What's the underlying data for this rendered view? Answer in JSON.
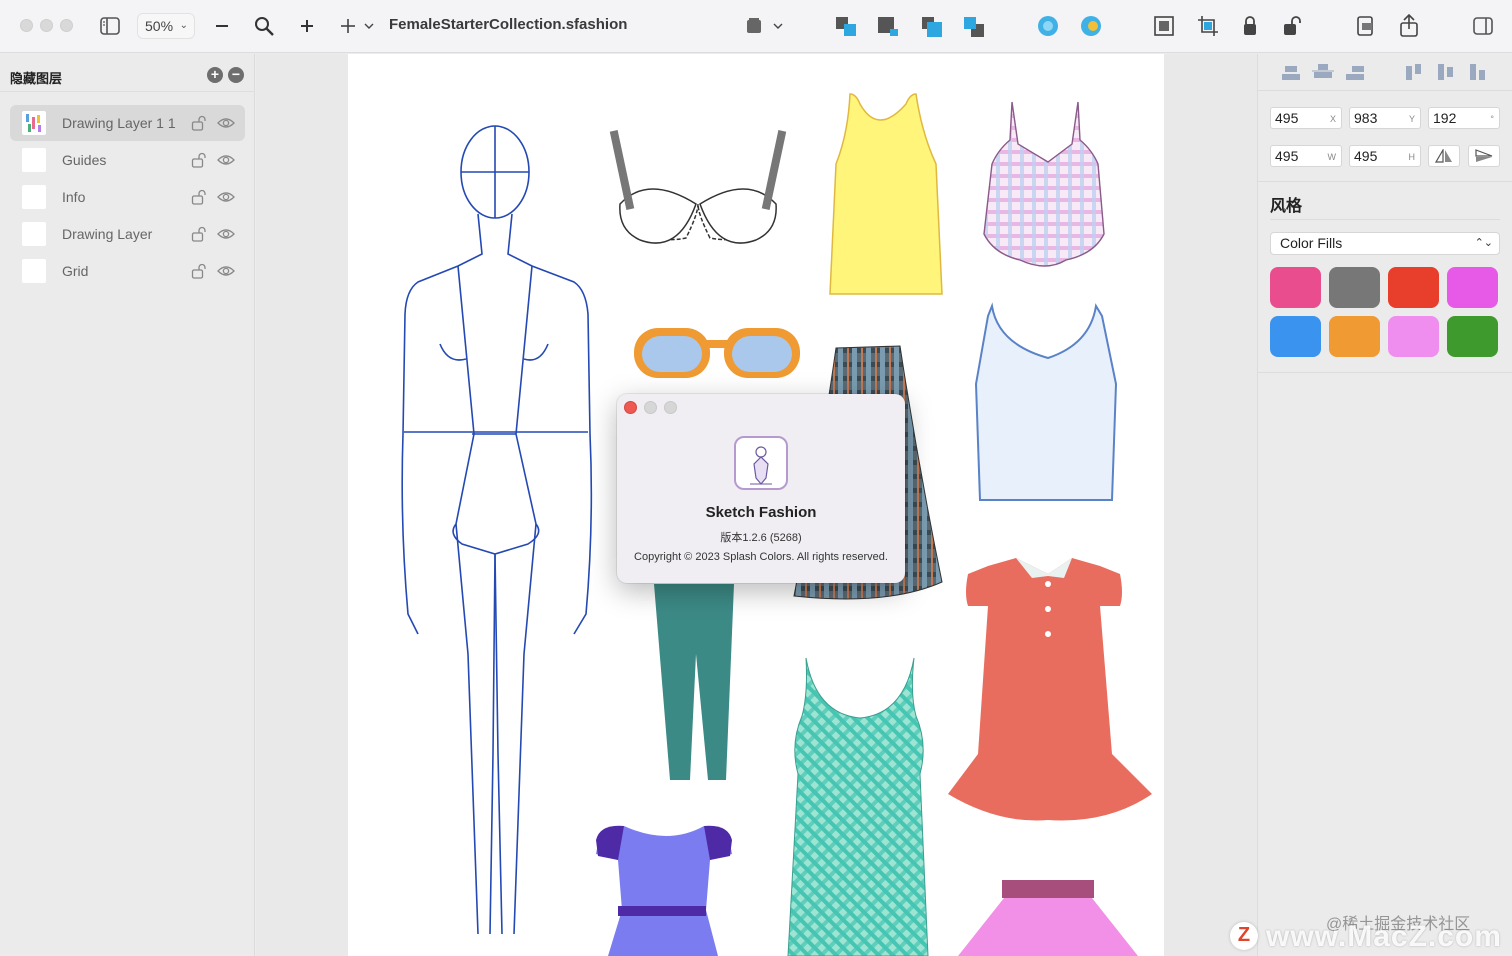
{
  "window": {
    "document_title": "FemaleStarterCollection.sfashion",
    "zoom_level": "50%"
  },
  "toolbar": {
    "icons": [
      "sidebar-toggle-icon",
      "zoom-out-icon",
      "magnifier-icon",
      "zoom-in-icon",
      "add-icon",
      "artboard-icon",
      "arrange-front-icon",
      "arrange-forward-icon",
      "arrange-backward-icon",
      "arrange-back-icon",
      "union-icon",
      "subtract-icon",
      "fit-icon",
      "crop-icon",
      "lock-icon",
      "unlock-icon",
      "export-icon",
      "share-icon",
      "inspector-toggle-icon"
    ]
  },
  "sidebar": {
    "header": "隐藏图层",
    "layers": [
      {
        "name": "Drawing Layer 1 1",
        "selected": true
      },
      {
        "name": "Guides",
        "selected": false
      },
      {
        "name": "Info",
        "selected": false
      },
      {
        "name": "Drawing Layer",
        "selected": false
      },
      {
        "name": "Grid",
        "selected": false
      }
    ]
  },
  "inspector": {
    "x_value": "495",
    "x_label": "X",
    "y_value": "983",
    "y_label": "Y",
    "rotation_value": "192",
    "rotation_label": "°",
    "w_value": "495",
    "w_label": "W",
    "h_value": "495",
    "h_label": "H",
    "style_title": "风格",
    "fill_select": "Color Fills",
    "swatches": [
      "#ea4d8e",
      "#777777",
      "#e83e2c",
      "#e75ae8",
      "#3b93f0",
      "#ef9a32",
      "#f08ef0",
      "#3e9a2c"
    ]
  },
  "about_dialog": {
    "app_name": "Sketch Fashion",
    "version": "版本1.2.6 (5268)",
    "copyright": "Copyright © 2023 Splash Colors. All rights reserved."
  },
  "watermark": {
    "line1": "@稀土掘金技术社区",
    "line2": "www.MacZ.com",
    "logo": "Z"
  }
}
